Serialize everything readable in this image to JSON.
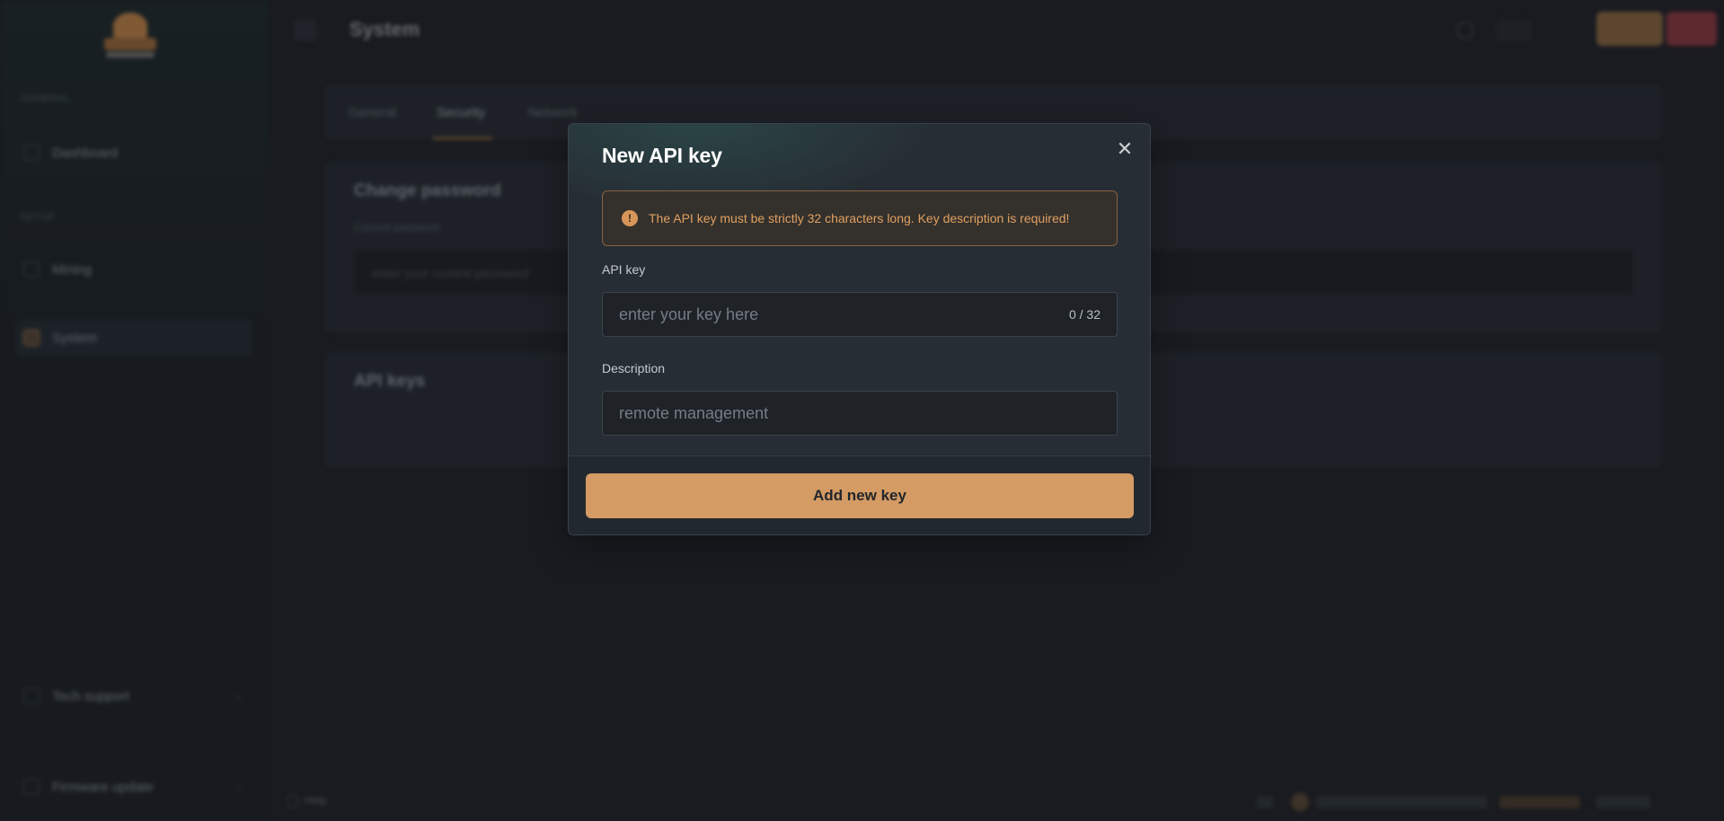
{
  "colors": {
    "accent": "#d49b64",
    "alert_text": "#e0a061",
    "alert_border": "#876440",
    "modal_bg": "#262d34",
    "page_bg": "#1f2227"
  },
  "background": {
    "page_title": "System",
    "sidebar": {
      "sections": [
        "GENERAL",
        "SETUP"
      ],
      "items": [
        {
          "label": "Dashboard",
          "icon": "dashboard-icon"
        },
        {
          "label": "Mining",
          "icon": "mining-icon"
        },
        {
          "label": "System",
          "icon": "system-icon",
          "active": true
        }
      ],
      "bottom_items": [
        {
          "label": "Tech support",
          "icon": "support-icon"
        },
        {
          "label": "Firmware update",
          "icon": "firmware-icon"
        }
      ]
    },
    "tabs": [
      "General",
      "Security",
      "Network"
    ],
    "active_tab": "Security",
    "cards": [
      {
        "title": "Change password",
        "label": "Current password",
        "placeholder": "enter your current password"
      },
      {
        "title": "API keys"
      }
    ],
    "footer": {
      "help": "Help"
    }
  },
  "modal": {
    "title": "New API key",
    "close_icon": "close-icon",
    "close_glyph": "✕",
    "alert": {
      "icon": "warning-icon",
      "glyph": "!",
      "text": "The API key must be strictly 32 characters long. Key description is required!"
    },
    "api_key": {
      "label": "API key",
      "value": "",
      "placeholder": "enter your key here",
      "counter": "0 / 32"
    },
    "description": {
      "label": "Description",
      "value": "",
      "placeholder": "remote management"
    },
    "submit_label": "Add new key"
  }
}
